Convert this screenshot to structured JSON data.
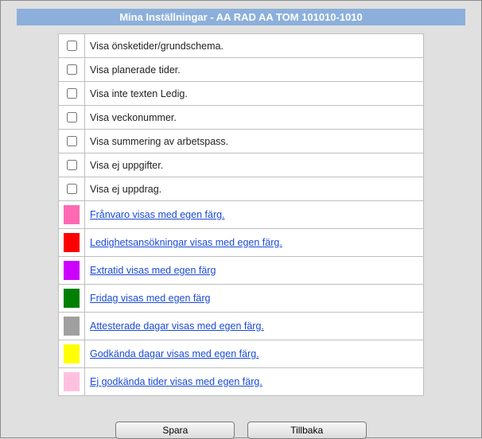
{
  "header": {
    "title": "Mina Inställningar - AA RAD AA TOM 101010-1010"
  },
  "checkbox_rows": [
    {
      "label": "Visa önsketider/grundschema."
    },
    {
      "label": "Visa planerade tider."
    },
    {
      "label": "Visa inte texten Ledig."
    },
    {
      "label": "Visa veckonummer."
    },
    {
      "label": "Visa summering av arbetspass."
    },
    {
      "label": "Visa ej uppgifter."
    },
    {
      "label": "Visa ej uppdrag."
    }
  ],
  "color_rows": [
    {
      "color": "#ff69b4",
      "label": " Frånvaro visas med egen färg."
    },
    {
      "color": "#ff0000",
      "label": " Ledighetsansökningar visas med egen färg."
    },
    {
      "color": "#cc00ff",
      "label": " Extratid visas med egen färg"
    },
    {
      "color": "#008000",
      "label": " Fridag visas med egen färg"
    },
    {
      "color": "#a0a0a0",
      "label": " Attesterade dagar visas med egen färg."
    },
    {
      "color": "#ffff00",
      "label": " Godkända dagar visas med egen färg."
    },
    {
      "color": "#ffc0e0",
      "label": " Ej godkända tider visas med egen färg."
    }
  ],
  "buttons": {
    "save": "Spara",
    "back": "Tillbaka"
  }
}
